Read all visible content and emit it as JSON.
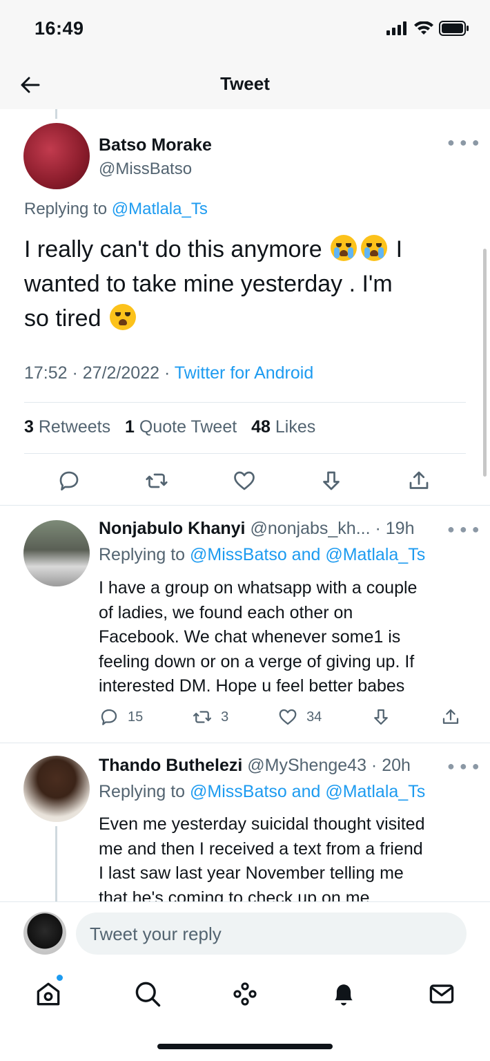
{
  "status_bar": {
    "time": "16:49"
  },
  "header": {
    "title": "Tweet"
  },
  "main_tweet": {
    "name": "Batso Morake",
    "handle": "@MissBatso",
    "replying_prefix": "Replying to ",
    "replying_to": "@Matlala_Ts",
    "text_line1": "I really can't do this anymore",
    "text_line1_tail": "I",
    "text_line2": "wanted to take mine yesterday . I'm",
    "text_line3": "so tired",
    "time": "17:52 · 27/2/2022 · ",
    "source": "Twitter for Android",
    "retweets_count": "3",
    "retweets_label": "Retweets",
    "quotes_count": "1",
    "quotes_label": "Quote Tweet",
    "likes_count": "48",
    "likes_label": "Likes"
  },
  "replies": [
    {
      "name": "Nonjabulo Khanyi",
      "meta": " @nonjabs_kh... · 19h",
      "replying_prefix": "Replying to ",
      "replying_to": "@MissBatso and @Matlala_Ts",
      "lines": [
        "I have a group on whatsapp with a couple",
        "of ladies, we found each other on",
        "Facebook. We chat whenever some1 is",
        "feeling down or on a verge of giving up. If",
        "interested DM. Hope u feel better babes"
      ],
      "reply_count": "15",
      "retweet_count": "3",
      "like_count": "34"
    },
    {
      "name": "Thando Buthelezi",
      "meta": " @MyShenge43 · 20h",
      "replying_prefix": "Replying to ",
      "replying_to": "@MissBatso and @Matlala_Ts",
      "lines": [
        "Even me yesterday suicidal thought visited",
        "me and then  I received a text from a friend",
        "I last saw last year November telling me",
        "that he's coming to check up on me."
      ]
    }
  ],
  "compose": {
    "placeholder": "Tweet your reply"
  },
  "icons": {
    "back": "arrow-left-icon",
    "more": "more-horizontal-icon",
    "reply": "reply-icon",
    "retweet": "retweet-icon",
    "like": "heart-icon",
    "bookmark": "bookmark-icon",
    "share": "share-icon",
    "tabs": [
      "home-icon",
      "search-icon",
      "spaces-icon",
      "notifications-icon",
      "messages-icon"
    ]
  },
  "colors": {
    "accent": "#1d9bf0",
    "text": "#0f1419",
    "muted": "#536471",
    "divider": "#e1e8ed"
  }
}
